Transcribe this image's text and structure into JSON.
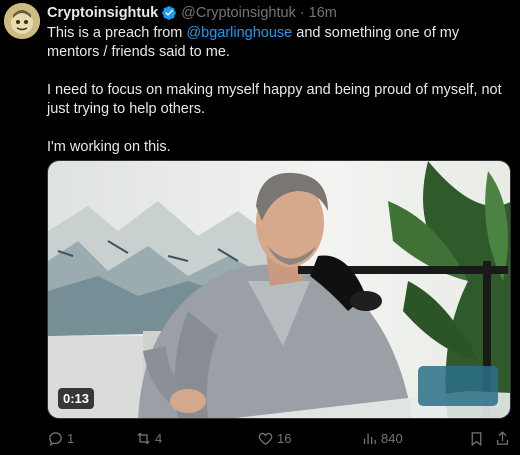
{
  "author": {
    "name": "Cryptoinsightuk",
    "handle": "@Cryptoinsightuk",
    "separator": "·",
    "time": "16m"
  },
  "tweet": {
    "line1_pre": "This is a preach from ",
    "mention": "@bgarlinghouse",
    "line1_post": " and something one of my mentors / friends said to me.",
    "para2": "I need to focus on making myself happy and being proud of myself, not just trying to help others.",
    "para3": "I'm working on this."
  },
  "media": {
    "duration": "0:13"
  },
  "actions": {
    "replies": "1",
    "reposts": "4",
    "likes": "16",
    "views": "840"
  },
  "colors": {
    "background": "#000000",
    "text": "#e7e9ea",
    "muted": "#71767b",
    "link": "#1d9bf0",
    "verified": "#1d9bf0"
  },
  "icons": [
    "reply-icon",
    "repost-icon",
    "like-icon",
    "views-icon",
    "bookmark-icon",
    "share-icon",
    "verified-badge-icon"
  ]
}
